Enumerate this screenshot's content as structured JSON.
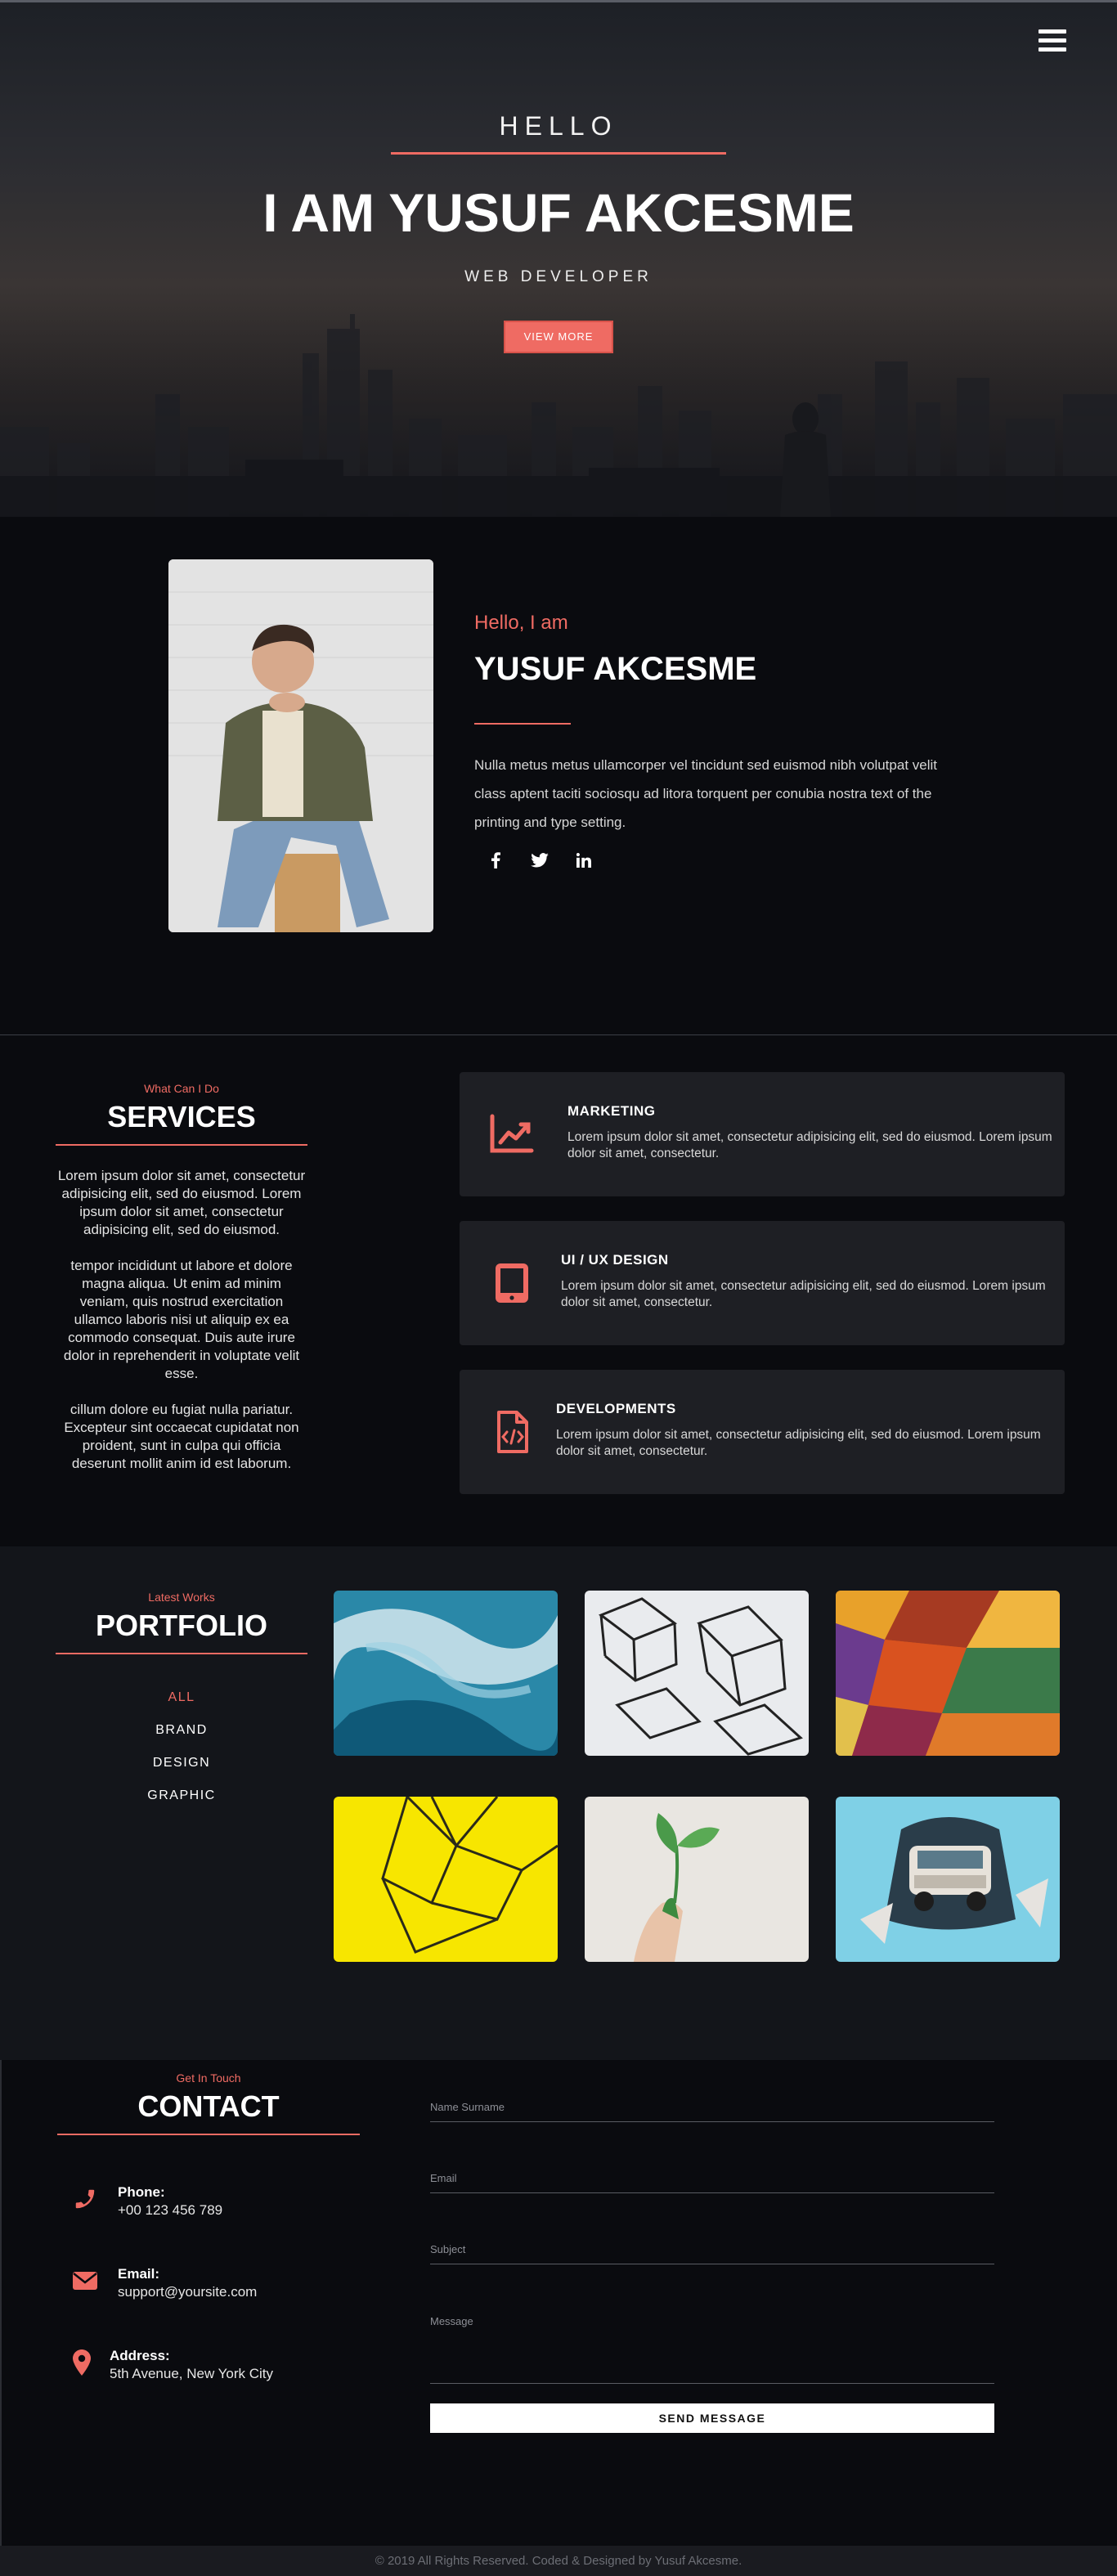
{
  "hero": {
    "hello": "HELLO",
    "name": "I AM YUSUF AKCESME",
    "role": "WEB DEVELOPER",
    "cta": "VIEW MORE",
    "menu_icon": "hamburger-menu-icon"
  },
  "about": {
    "greeting": "Hello, I am",
    "name": "YUSUF AKCESME",
    "text": "Nulla metus metus ullamcorper vel tincidunt sed euismod nibh volutpat velit class aptent taciti sociosqu ad litora torquent per conubia nostra text of the printing and type setting.",
    "socials": [
      "facebook-icon",
      "twitter-icon",
      "linkedin-icon"
    ]
  },
  "services": {
    "subtitle": "What Can I Do",
    "title": "SERVICES",
    "paragraphs": [
      "Lorem ipsum dolor sit amet, consectetur adipisicing elit, sed do eiusmod. Lorem ipsum dolor sit amet, consectetur adipisicing elit, sed do eiusmod.",
      "tempor incididunt ut labore et dolore magna aliqua. Ut enim ad minim veniam, quis nostrud exercitation ullamco laboris nisi ut aliquip ex ea commodo consequat. Duis aute irure dolor in reprehenderit in voluptate velit esse.",
      "cillum dolore eu fugiat nulla pariatur. Excepteur sint occaecat cupidatat non proident, sunt in culpa qui officia deserunt mollit anim id est laborum."
    ],
    "cards": [
      {
        "title": "MARKETING",
        "text": "Lorem ipsum dolor sit amet, consectetur adipisicing elit, sed do eiusmod. Lorem ipsum dolor sit amet, consectetur.",
        "icon": "chart-line-icon"
      },
      {
        "title": "UI / UX DESIGN",
        "text": "Lorem ipsum dolor sit amet, consectetur adipisicing elit, sed do eiusmod. Lorem ipsum dolor sit amet, consectetur.",
        "icon": "tablet-icon"
      },
      {
        "title": "DEVELOPMENTS",
        "text": "Lorem ipsum dolor sit amet, consectetur adipisicing elit, sed do eiusmod. Lorem ipsum dolor sit amet, consectetur.",
        "icon": "code-file-icon"
      }
    ]
  },
  "portfolio": {
    "subtitle": "Latest Works",
    "title": "PORTFOLIO",
    "filters": [
      "ALL",
      "BRAND",
      "DESIGN",
      "GRAPHIC"
    ],
    "active_filter": "ALL"
  },
  "contact": {
    "subtitle": "Get In Touch",
    "title": "CONTACT",
    "phone_label": "Phone:",
    "phone": "+00 123 456 789",
    "email_label": "Email:",
    "email": "support@yoursite.com",
    "address_label": "Address:",
    "address": "5th Avenue, New York City",
    "form": {
      "name_placeholder": "Name Surname",
      "email_placeholder": "Email",
      "subject_placeholder": "Subject",
      "message_placeholder": "Message",
      "submit": "SEND MESSAGE"
    }
  },
  "footer": {
    "text": "© 2019 All Rights Reserved. Coded & Designed by Yusuf Akcesme."
  },
  "colors": {
    "accent": "#ef6b63",
    "background": "#0a0b0f",
    "card": "#1e1f24"
  }
}
